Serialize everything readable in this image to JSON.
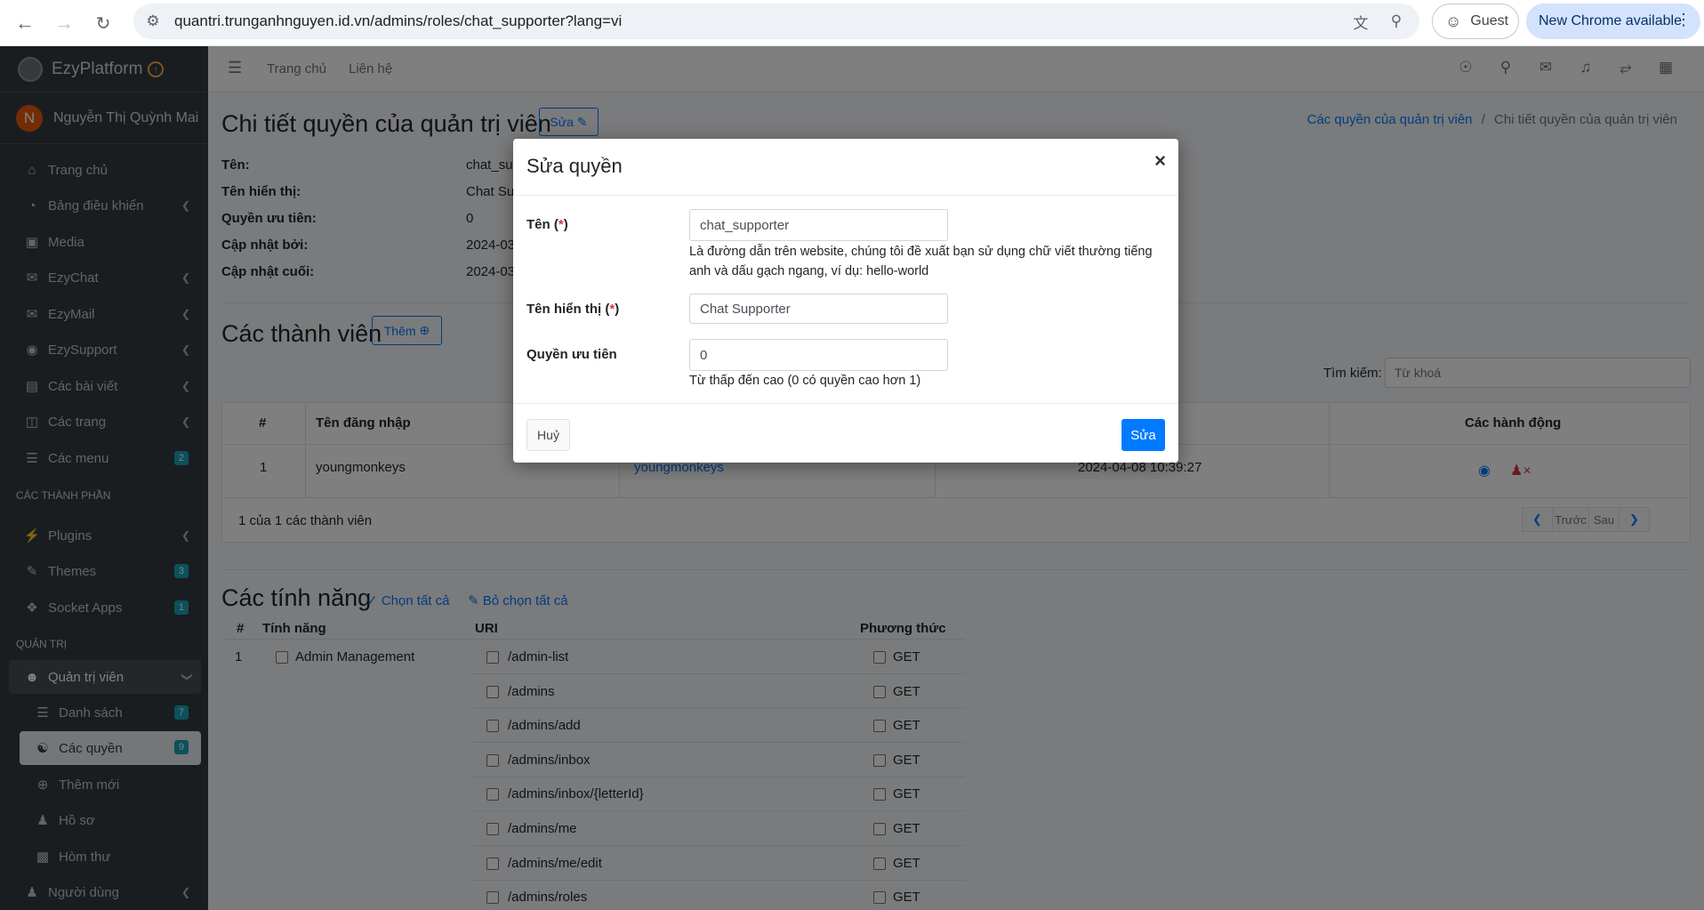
{
  "browser": {
    "url": "quantri.trunganhnguyen.id.vn/admins/roles/chat_supporter?lang=vi",
    "profile_label": "Guest",
    "update_label": "New Chrome available"
  },
  "sidebar": {
    "brand": "EzyPlatform",
    "user_initial": "N",
    "user_name": "Nguyễn Thị Quỳnh Mai",
    "items": [
      {
        "label": "Trang chủ"
      },
      {
        "label": "Bảng điều khiển"
      },
      {
        "label": "Media"
      },
      {
        "label": "EzyChat"
      },
      {
        "label": "EzyMail"
      },
      {
        "label": "EzySupport"
      },
      {
        "label": "Các bài viết"
      },
      {
        "label": "Các trang"
      },
      {
        "label": "Các menu",
        "badge": "2"
      }
    ],
    "header_components": "CÁC THÀNH PHẦN",
    "component_items": [
      {
        "label": "Plugins"
      },
      {
        "label": "Themes",
        "badge": "3"
      },
      {
        "label": "Socket Apps",
        "badge": "1"
      }
    ],
    "header_admin": "QUẢN TRỊ",
    "admin_parent": "Quản trị viên",
    "admin_items": [
      {
        "label": "Danh sách",
        "badge": "7"
      },
      {
        "label": "Các quyền",
        "badge": "9"
      },
      {
        "label": "Thêm mới"
      },
      {
        "label": "Hồ sơ"
      },
      {
        "label": "Hòm thư"
      }
    ],
    "users_item": "Người dùng"
  },
  "topnav": {
    "home": "Trang chủ",
    "contact": "Liên hệ"
  },
  "page": {
    "title": "Chi tiết quyền của quản trị viên",
    "edit_btn": "Sửa",
    "breadcrumb_parent": "Các quyền của quản trị viên",
    "breadcrumb_sep": "/",
    "breadcrumb_current": "Chi tiết quyền của quản trị viên",
    "info": [
      {
        "label": "Tên:",
        "value": "chat_sup"
      },
      {
        "label": "Tên hiển thị:",
        "value": "Chat Sup"
      },
      {
        "label": "Quyền ưu tiên:",
        "value": "0"
      },
      {
        "label": "Cập nhật bởi:",
        "value": "2024-03-"
      },
      {
        "label": "Cập nhật cuối:",
        "value": "2024-03-"
      }
    ],
    "members_title": "Các thành viên",
    "add_btn": "Thêm",
    "search_label": "Tìm kiếm:",
    "search_placeholder": "Từ khoá",
    "members_table": {
      "headers": [
        "#",
        "Tên đăng nhập",
        "",
        "",
        "Các hành động"
      ],
      "rows": [
        {
          "index": "1",
          "username": "youngmonkeys",
          "link": "youngmonkeys",
          "date": "2024-04-08 10:39:27"
        }
      ]
    },
    "members_summary": "1 của 1 các thành viên",
    "pager_prev": "Trước",
    "pager_next": "Sau",
    "features_title": "Các tính năng",
    "select_all": "Chọn tất cả",
    "deselect_all": "Bỏ chọn tất cả",
    "features_headers": {
      "index": "#",
      "feature": "Tính năng",
      "uri": "URI",
      "method": "Phương thức"
    },
    "feature_name": "Admin Management",
    "feature_index": "1",
    "uris": [
      {
        "uri": "/admin-list",
        "method": "GET"
      },
      {
        "uri": "/admins",
        "method": "GET"
      },
      {
        "uri": "/admins/add",
        "method": "GET"
      },
      {
        "uri": "/admins/inbox",
        "method": "GET"
      },
      {
        "uri": "/admins/inbox/{letterId}",
        "method": "GET"
      },
      {
        "uri": "/admins/me",
        "method": "GET"
      },
      {
        "uri": "/admins/me/edit",
        "method": "GET"
      },
      {
        "uri": "/admins/roles",
        "method": "GET"
      }
    ]
  },
  "modal": {
    "title": "Sửa quyền",
    "close": "×",
    "name_label": "Tên",
    "name_value": "chat_supporter",
    "name_help": "Là đường dẫn trên website, chúng tôi đề xuất bạn sử dụng chữ viết thường tiếng anh và dấu gạch ngang, ví dụ: hello-world",
    "display_label": "Tên hiển thị",
    "display_value": "Chat Supporter",
    "priority_label": "Quyền ưu tiên",
    "priority_value": "0",
    "priority_help": "Từ thấp đến cao (0 có quyền cao hơn 1)",
    "required_mark": "*",
    "cancel": "Huỷ",
    "save": "Sửa"
  },
  "colors": {
    "primary": "#007bff",
    "sidebar": "#343a40",
    "danger": "#dc3545",
    "badge": "#17a2b8"
  }
}
